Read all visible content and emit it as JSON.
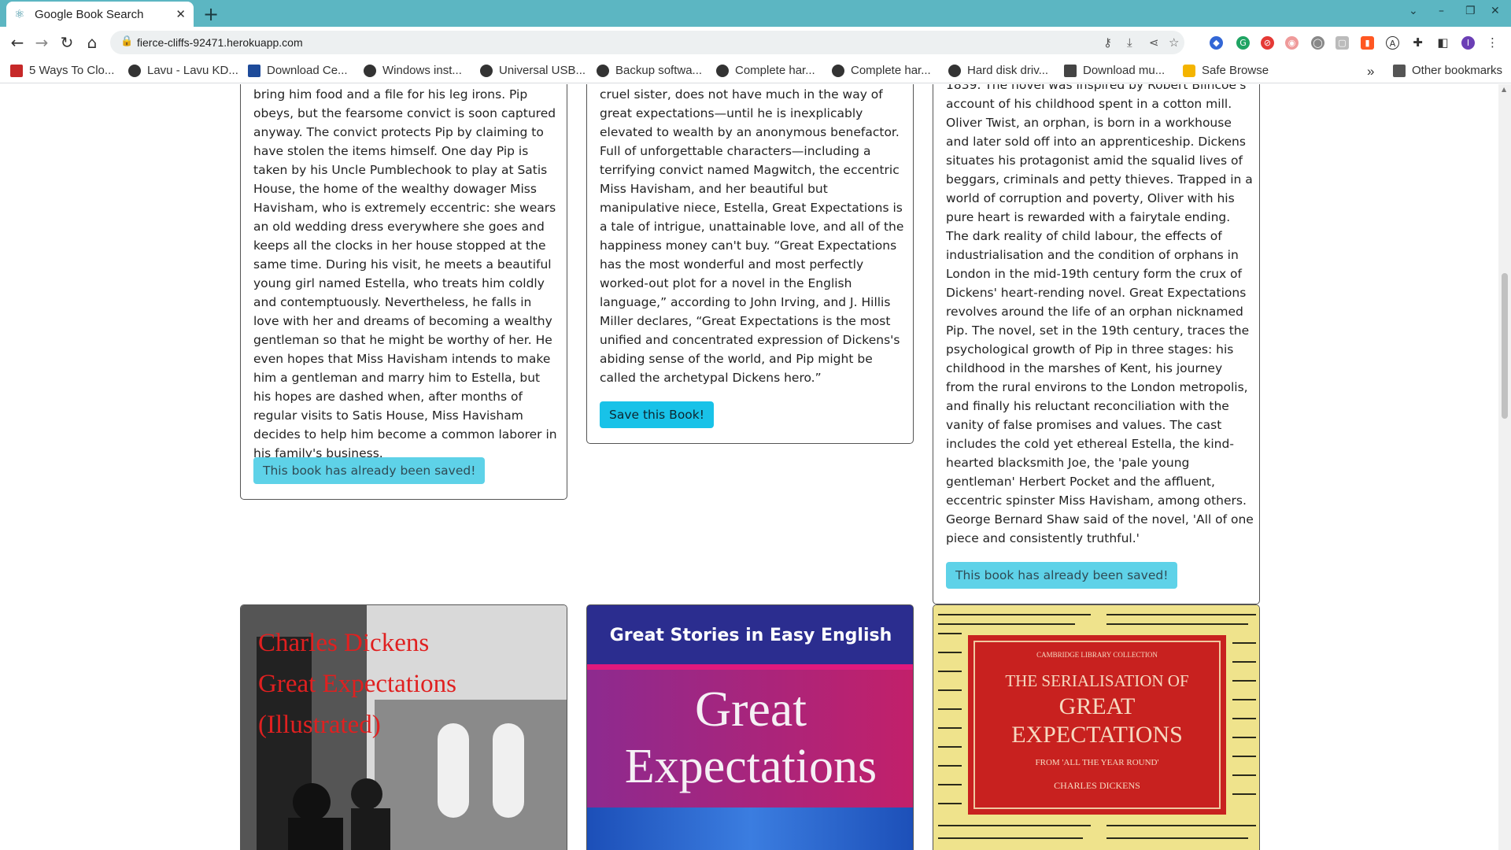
{
  "browser": {
    "tab_title": "Google Book Search",
    "new_tab": "+",
    "url": "fierce-cliffs-92471.herokuapp.com",
    "bookmarks": [
      "5 Ways To Clo...",
      "Lavu - Lavu KD...",
      "Download Ce...",
      "Windows inst...",
      "Universal USB...",
      "Backup softwa...",
      "Complete har...",
      "Complete har...",
      "Hard disk driv...",
      "Download mu...",
      "Safe Browse"
    ],
    "bookmarks_overflow": "»",
    "other_bookmarks": "Other bookmarks",
    "profile_initial": "I"
  },
  "books": [
    {
      "description": "bring him food and a file for his leg irons. Pip obeys, but the fearsome convict is soon captured anyway. The convict protects Pip by claiming to have stolen the items himself. One day Pip is taken by his Uncle Pumblechook to play at Satis House, the home of the wealthy dowager Miss Havisham, who is extremely eccentric: she wears an old wedding dress everywhere she goes and keeps all the clocks in her house stopped at the same time. During his visit, he meets a beautiful young girl named Estella, who treats him coldly and contemptuously. Nevertheless, he falls in love with her and dreams of becoming a wealthy gentleman so that he might be worthy of her. He even hopes that Miss Havisham intends to make him a gentleman and marry him to Estella, but his hopes are dashed when, after months of regular visits to Satis House, Miss Havisham decides to help him become a common laborer in his family's business.",
      "button": "This book has already been saved!"
    },
    {
      "description": "cruel sister, does not have much in the way of great expectations—until he is inexplicably elevated to wealth by an anonymous benefactor. Full of unforgettable characters—including a terrifying convict named Magwitch, the eccentric Miss Havisham, and her beautiful but manipulative niece, Estella, Great Expectations is a tale of intrigue, unattainable love, and all of the happiness money can't buy. “Great Expectations has the most wonderful and most perfectly worked-out plot for a novel in the English language,” according to John Irving, and J. Hillis Miller declares, “Great Expectations is the most unified and concentrated expression of Dickens's abiding sense of the world, and Pip might be called the archetypal Dickens hero.”",
      "button": "Save this Book!"
    },
    {
      "description": "1839. The novel was inspired by Robert Blincoe's account of his childhood spent in a cotton mill. Oliver Twist, an orphan, is born in a workhouse and later sold off into an apprenticeship. Dickens situates his protagonist amid the squalid lives of beggars, criminals and petty thieves. Trapped in a world of corruption and poverty, Oliver with his pure heart is rewarded with a fairytale ending. The dark reality of child labour, the effects of industrialisation and the condition of orphans in London in the mid-19th century form the crux of Dickens' heart-rending novel. Great Expectations revolves around the life of an orphan nicknamed Pip. The novel, set in the 19th century, traces the psychological growth of Pip in three stages: his childhood in the marshes of Kent, his journey from the rural environs to the London metropolis, and finally his reluctant reconciliation with the vanity of false promises and values. The cast includes the cold yet ethereal Estella, the kind-hearted blacksmith Joe, the 'pale young gentleman' Herbert Pocket and the affluent, eccentric spinster Miss Havisham, among others. George Bernard Shaw said of the novel, 'All of one piece and consistently truthful.'",
      "button": "This book has already been saved!"
    }
  ],
  "covers": [
    {
      "lines": [
        "Charles Dickens",
        "Great Expectations",
        "(Illustrated)"
      ]
    },
    {
      "banner": "Great Stories in Easy English",
      "title_line1": "Great",
      "title_line2": "Expectations"
    },
    {
      "series": "CAMBRIDGE LIBRARY COLLECTION",
      "title_line1": "THE SERIALISATION OF",
      "title_line2": "GREAT",
      "title_line3": "EXPECTATIONS",
      "subtitle": "FROM 'ALL THE YEAR ROUND'",
      "author": "CHARLES DICKENS"
    }
  ],
  "colors": {
    "tabbar": "#5cb6c2",
    "saved_button": "#5ed2e8",
    "save_button": "#18c2e8"
  }
}
